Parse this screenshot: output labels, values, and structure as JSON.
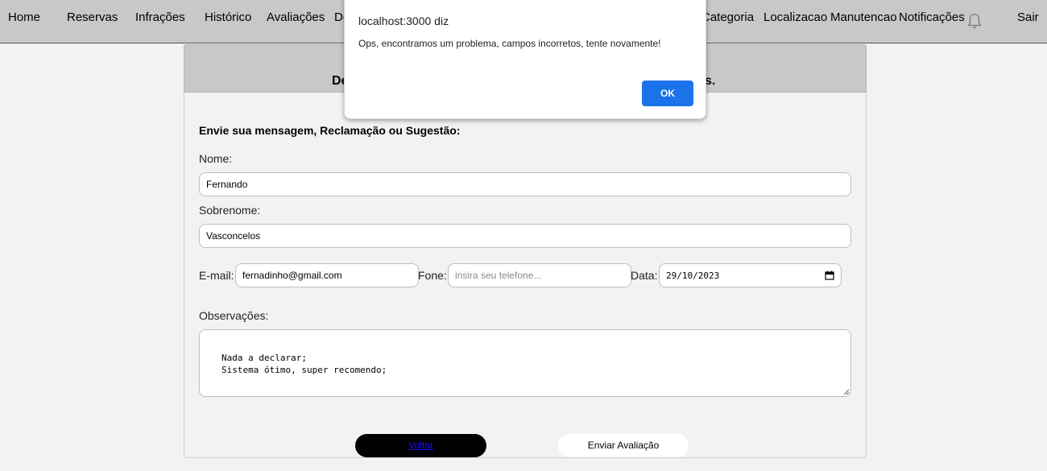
{
  "nav": {
    "items": [
      "Home",
      "Reservas",
      "Infrações",
      "Histórico",
      "Avaliações",
      "De",
      "Categoria",
      "Localizacao",
      "Manutencao",
      "Notificações",
      "Sair"
    ],
    "notification_icon": "bell-icon"
  },
  "header": {
    "title_start": "De",
    "title_end": "s."
  },
  "form": {
    "heading": "Envie sua mensagem, Reclamação ou Sugestão:",
    "nome_label": "Nome:",
    "nome_value": "Fernando",
    "sobrenome_label": "Sobrenome:",
    "sobrenome_value": "Vasconcelos",
    "email_label": "E-mail:",
    "email_value": "fernadinho@gmail.com",
    "fone_label": "Fone:",
    "fone_placeholder": "insira seu telefone...",
    "data_label": "Data:",
    "data_value": "29/10/2023",
    "obs_label": "Observações:",
    "obs_value": "Nada a declarar;\nSistema ótimo, super recomendo;",
    "voltar_label": "Voltar",
    "enviar_label": "Enviar Avaliação"
  },
  "dialog": {
    "title": "localhost:3000 diz",
    "message": "Ops, encontramos um problema, campos incorretos, tente novamente!",
    "ok_label": "OK"
  },
  "colors": {
    "nav_bg": "#c8c8c8",
    "page_bg": "#f2f2f2",
    "ok_button": "#1a73e8",
    "voltar_button": "#000000",
    "voltar_link": "#1a0dff"
  }
}
